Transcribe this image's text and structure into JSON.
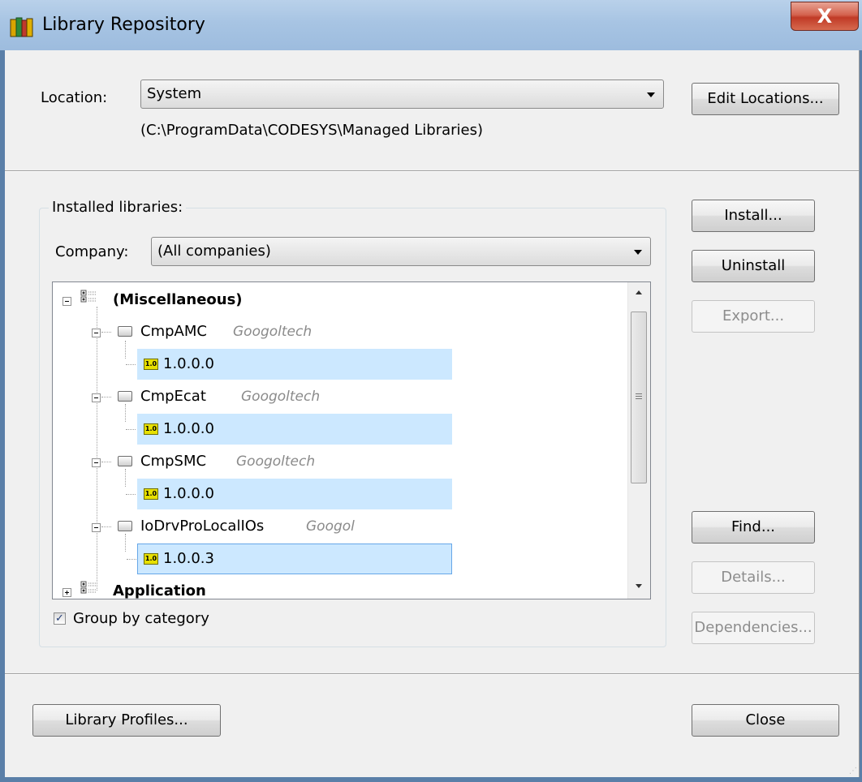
{
  "window": {
    "title": "Library Repository",
    "close_label": "X"
  },
  "location": {
    "label": "Location:",
    "value": "System",
    "path": "(C:\\ProgramData\\CODESYS\\Managed Libraries)",
    "edit_button": "Edit Locations..."
  },
  "installed": {
    "group_label": "Installed libraries:",
    "company_label": "Company:",
    "company_value": "(All companies)"
  },
  "tree": {
    "groups": [
      {
        "label": "(Miscellaneous)",
        "expanded": true
      },
      {
        "label": "Application",
        "expanded": false
      }
    ],
    "libraries": [
      {
        "name": "CmpAMC",
        "company": "Googoltech",
        "version": "1.0.0.0"
      },
      {
        "name": "CmpEcat",
        "company": "Googoltech",
        "version": "1.0.0.0"
      },
      {
        "name": "CmpSMC",
        "company": "Googoltech",
        "version": "1.0.0.0"
      },
      {
        "name": "IoDrvProLocalIOs",
        "company": "Googol",
        "version": "1.0.0.3"
      }
    ],
    "version_icon_label": "1.0"
  },
  "group_by_category": {
    "label": "Group by category",
    "checked": true,
    "mark": "✓"
  },
  "buttons": {
    "install": "Install...",
    "uninstall": "Uninstall",
    "export": "Export...",
    "find": "Find...",
    "details": "Details...",
    "dependencies": "Dependencies...",
    "library_profiles": "Library Profiles...",
    "close": "Close"
  },
  "colors": {
    "selection": "#cce8ff",
    "titlebar": "#a7c4e3",
    "close_button": "#c03a26"
  }
}
